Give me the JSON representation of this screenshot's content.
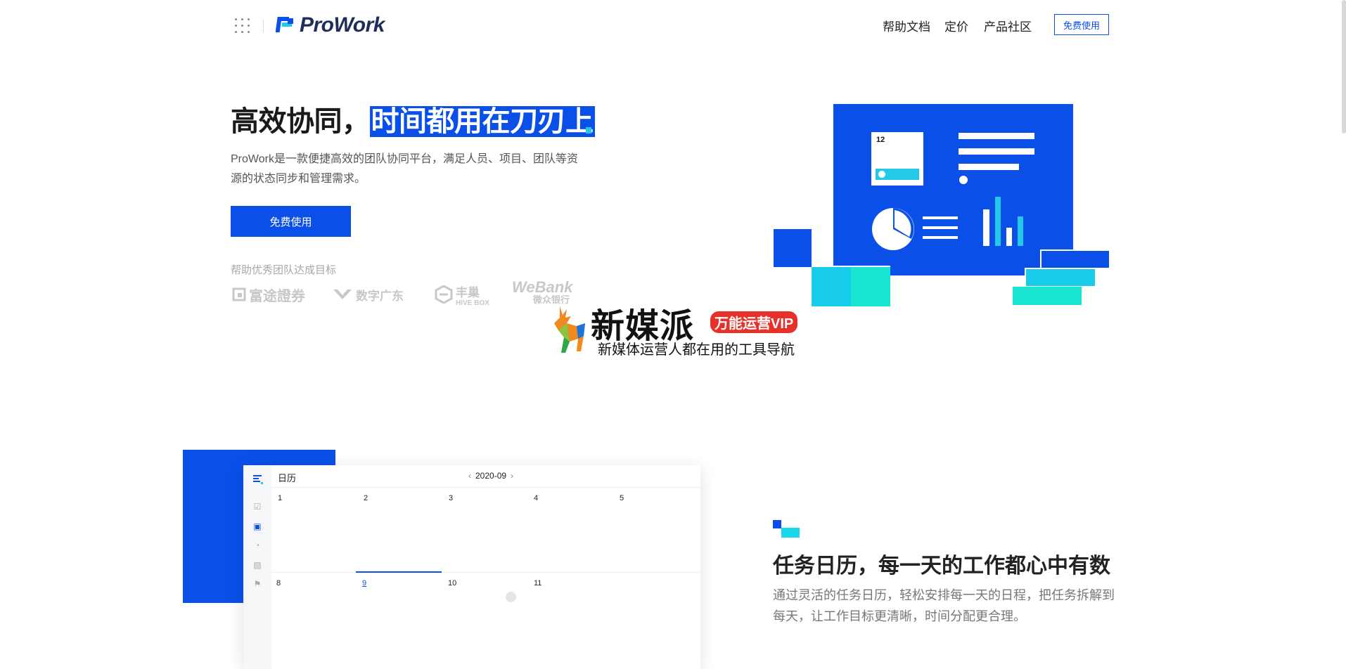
{
  "header": {
    "logo_text": "ProWork",
    "nav": [
      "帮助文档",
      "定价",
      "产品社区"
    ],
    "cta": "免费使用"
  },
  "hero": {
    "title_plain": "高效协同，",
    "title_highlight": "时间都用在刀刃上",
    "description": "ProWork是一款便捷高效的团队协同平台，满足人员、项目、团队等资源的状态同步和管理需求。",
    "cta": "免费使用",
    "partners_label": "帮助优秀团队达成目标",
    "partners": [
      {
        "name": "富途證券",
        "sub": ""
      },
      {
        "name": "数字广东",
        "sub": ""
      },
      {
        "name": "丰巢",
        "sub": "HIVE BOX"
      },
      {
        "name": "WeBank",
        "sub": "微众银行"
      }
    ],
    "illustration": {
      "card_number": "12"
    }
  },
  "watermark": {
    "title": "新媒派",
    "badge": "万能运营VIP",
    "subtitle": "新媒体运营人都在用的工具导航"
  },
  "calendar_section": {
    "calendar": {
      "title": "日历",
      "month": "2020-09",
      "week1": [
        "1",
        "2",
        "3",
        "4",
        "5"
      ],
      "week2": [
        "8",
        "9",
        "10",
        "11"
      ],
      "today": "9"
    },
    "title": "任务日历，每一天的工作都心中有数",
    "description": "通过灵活的任务日历，轻松安排每一天的日程，把任务拆解到每天，让工作目标更清晰，时间分配更合理。"
  },
  "colors": {
    "brand_blue": "#0a50e8",
    "accent_cyan": "#17d8ea",
    "accent_teal": "#19e6d0",
    "watermark_red": "#e8302a"
  },
  "icons": [
    "app-grid-icon",
    "prowork-logo-icon",
    "calendar-check-icon",
    "calendar-icon",
    "pie-chart-icon",
    "inbox-icon",
    "bell-icon",
    "chevron-left-icon",
    "chevron-right-icon",
    "deer-logo-icon"
  ]
}
